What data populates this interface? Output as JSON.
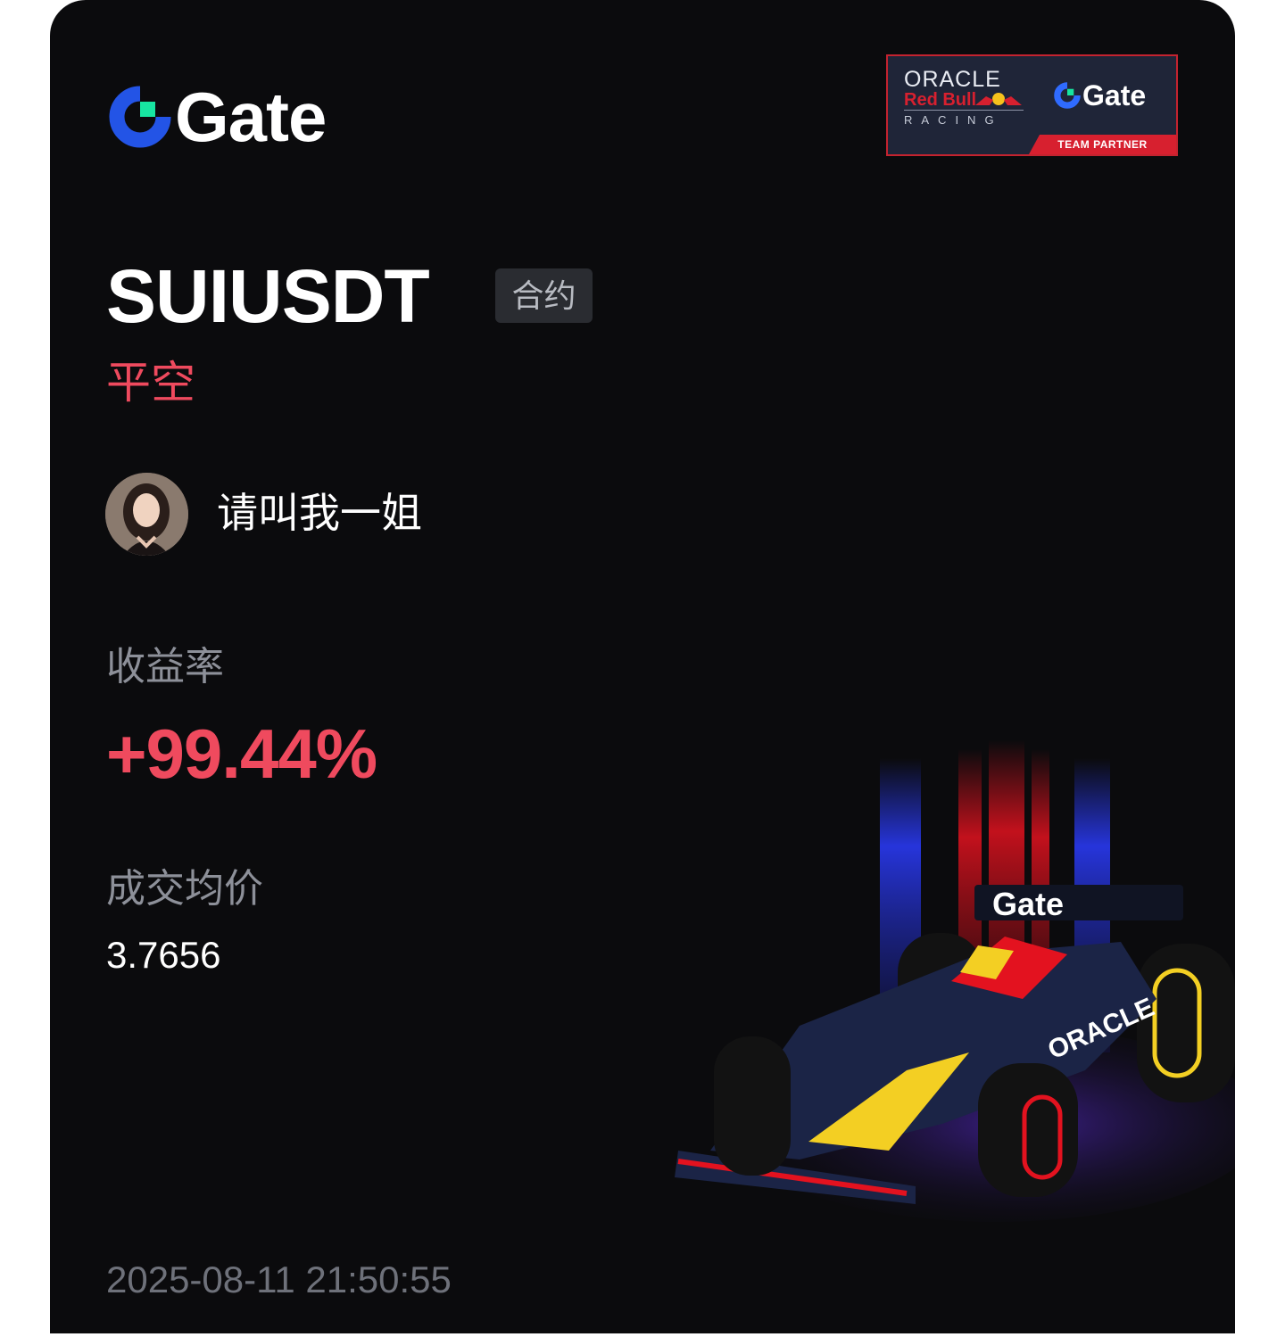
{
  "brand": {
    "name": "Gate",
    "accent": "#2354e6",
    "green": "#17e5a1"
  },
  "partner_badge": {
    "oracle": "ORACLE",
    "redbull": "Red Bull",
    "racing": "RACING",
    "gate": "Gate",
    "banner": "TEAM PARTNER"
  },
  "trade": {
    "symbol": "SUIUSDT",
    "type_tag": "合约",
    "side": "平空"
  },
  "user": {
    "name": "请叫我一姐"
  },
  "stats": {
    "ror_label": "收益率",
    "ror_value": "+99.44%",
    "avg_price_label": "成交均价",
    "avg_price_value": "3.7656"
  },
  "timestamp": "2025-08-11 21:50:55",
  "colors": {
    "positive": "#ef4a5e",
    "muted": "#8d9099",
    "background": "#0b0b0d"
  }
}
